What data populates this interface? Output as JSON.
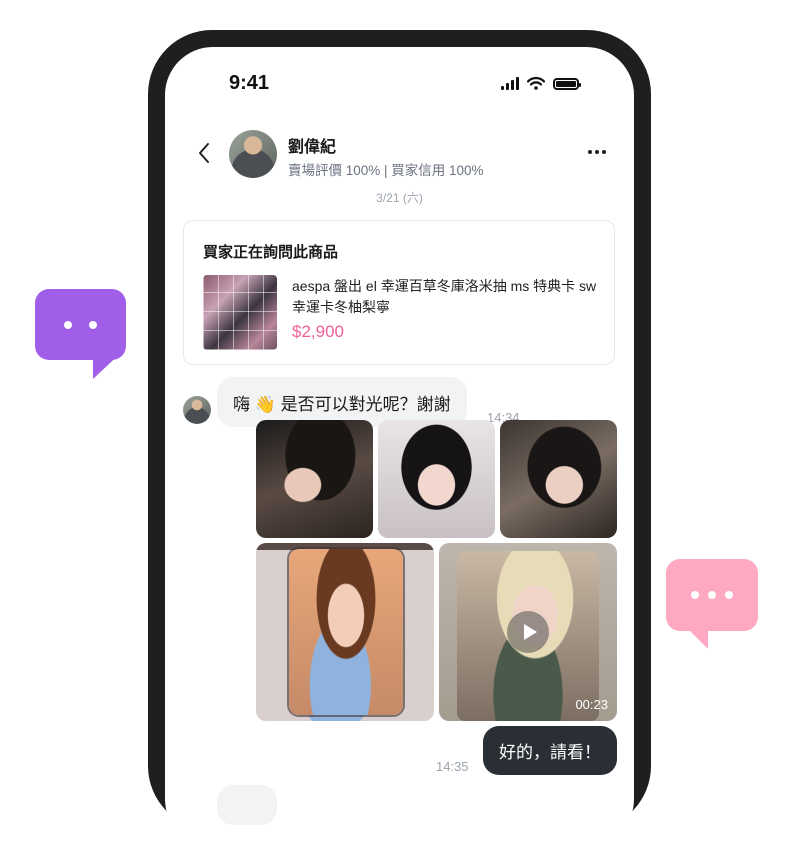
{
  "status_bar": {
    "time": "9:41"
  },
  "header": {
    "seller_name": "劉偉紀",
    "seller_meta": "賣場評價 100% | 買家信用 100%"
  },
  "date_separator": "3/21 (六)",
  "product_card": {
    "heading": "買家正在詢問此商品",
    "title": "aespa 盤出 el 幸運百草冬庫洛米抽 ms 特典卡 sw 幸運卡冬柚梨寧",
    "price": "$2,900"
  },
  "messages": {
    "incoming_text": "嗨 👋 是否可以對光呢？謝謝",
    "incoming_time": "14:34",
    "video_duration": "00:23",
    "outgoing_text": "好的，請看！",
    "outgoing_time": "14:35"
  },
  "colors": {
    "purple_bubble": "#a15ee8",
    "pink_bubble": "#ffa8c2",
    "price": "#f0619a",
    "outgoing_bubble": "#2a2f35"
  },
  "icons": {
    "back": "chevron-left-icon",
    "more": "more-horizontal-icon",
    "play": "play-icon",
    "signal": "signal-icon",
    "wifi": "wifi-icon",
    "battery": "battery-icon"
  }
}
